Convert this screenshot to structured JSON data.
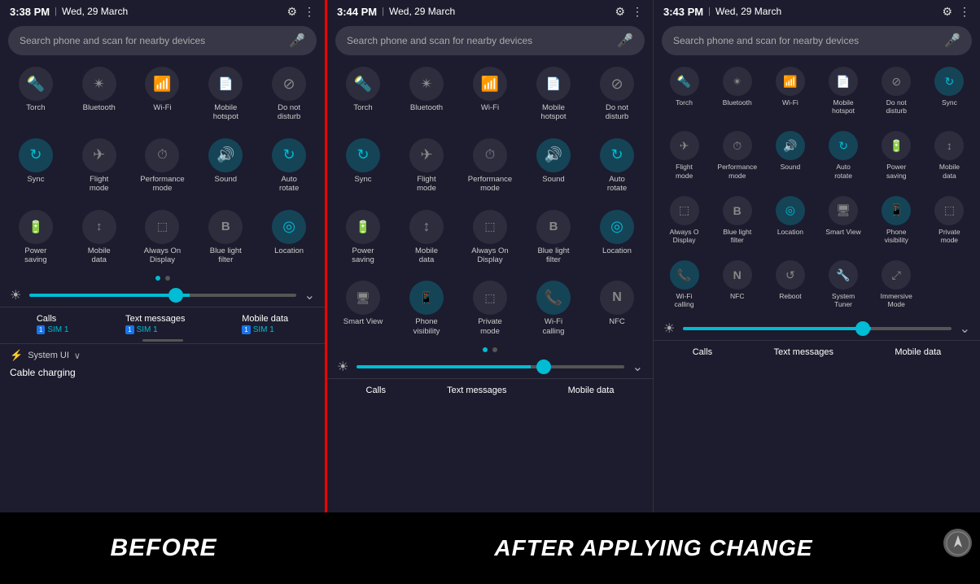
{
  "screens": {
    "before": {
      "time": "3:38 PM",
      "date": "Wed, 29 March",
      "search_placeholder": "Search phone and scan for nearby devices",
      "page1_items": [
        {
          "icon": "🔦",
          "label": "Torch",
          "active": false
        },
        {
          "icon": "⊛",
          "label": "Bluetooth",
          "active": false
        },
        {
          "icon": "≋",
          "label": "Wi-Fi",
          "active": false
        },
        {
          "icon": "⊡",
          "label": "Mobile\nhotspot",
          "active": false
        },
        {
          "icon": "⊘",
          "label": "Do not\ndisturb",
          "active": false
        },
        {
          "icon": "↻",
          "label": "Sync",
          "active": false
        },
        {
          "icon": "✈",
          "label": "Flight\nmode",
          "active": false
        },
        {
          "icon": "⊙",
          "label": "Performance\nmode",
          "active": false
        },
        {
          "icon": "🔊",
          "label": "Sound",
          "active": true
        },
        {
          "icon": "↻",
          "label": "Auto\nrotate",
          "active": true
        },
        {
          "icon": "⊟",
          "label": "Power\nsaving",
          "active": false
        },
        {
          "icon": "↕",
          "label": "Mobile\ndata",
          "active": false
        },
        {
          "icon": "⊡",
          "label": "Always On\nDisplay",
          "active": false
        },
        {
          "icon": "B",
          "label": "Blue light\nfilter",
          "active": false
        },
        {
          "icon": "◎",
          "label": "Location",
          "active": true
        }
      ],
      "calls_label": "Calls",
      "calls_sim": "SIM 1",
      "texts_label": "Text messages",
      "texts_sim": "SIM 1",
      "data_label": "Mobile data",
      "data_sim": "SIM 1",
      "system_label": "System UI",
      "charging_label": "Cable charging"
    },
    "after1": {
      "time": "3:44 PM",
      "date": "Wed, 29 March",
      "search_placeholder": "Search phone and scan for nearby devices",
      "page1_items": [
        {
          "icon": "🔦",
          "label": "Torch",
          "active": false
        },
        {
          "icon": "⊛",
          "label": "Bluetooth",
          "active": false
        },
        {
          "icon": "≋",
          "label": "Wi-Fi",
          "active": false
        },
        {
          "icon": "⊡",
          "label": "Mobile\nhotspot",
          "active": false
        },
        {
          "icon": "⊘",
          "label": "Do not\ndisturb",
          "active": false
        },
        {
          "icon": "↻",
          "label": "Sync",
          "active": false
        },
        {
          "icon": "✈",
          "label": "Flight\nmode",
          "active": false
        },
        {
          "icon": "⊙",
          "label": "Performance\nmode",
          "active": false
        },
        {
          "icon": "🔊",
          "label": "Sound",
          "active": true
        },
        {
          "icon": "↻",
          "label": "Auto\nrotate",
          "active": true
        },
        {
          "icon": "⊟",
          "label": "Power\nsaving",
          "active": false
        },
        {
          "icon": "↕",
          "label": "Mobile\ndata",
          "active": false
        },
        {
          "icon": "⊡",
          "label": "Always On\nDisplay",
          "active": false
        },
        {
          "icon": "B",
          "label": "Blue light\nfilter",
          "active": false
        },
        {
          "icon": "◎",
          "label": "Location",
          "active": true
        },
        {
          "icon": "🖥",
          "label": "Smart View",
          "active": false
        },
        {
          "icon": "📱",
          "label": "Phone\nvisibility",
          "active": true
        },
        {
          "icon": "⊡",
          "label": "Private\nmode",
          "active": false
        },
        {
          "icon": "📞",
          "label": "Wi-Fi\ncalling",
          "active": true
        },
        {
          "icon": "N",
          "label": "NFC",
          "active": false
        }
      ],
      "calls_label": "Calls",
      "texts_label": "Text messages",
      "data_label": "Mobile data"
    },
    "after2": {
      "time": "3:43 PM",
      "date": "Wed, 29 March",
      "search_placeholder": "Search phone and scan for nearby devices",
      "page1_items": [
        {
          "icon": "🔦",
          "label": "Torch",
          "active": false
        },
        {
          "icon": "⊛",
          "label": "Bluetooth",
          "active": false
        },
        {
          "icon": "≋",
          "label": "Wi-Fi",
          "active": false
        },
        {
          "icon": "⊡",
          "label": "Mobile\nhotspot",
          "active": false
        },
        {
          "icon": "⊘",
          "label": "Do not\ndisturb",
          "active": false
        },
        {
          "icon": "↻",
          "label": "Sync",
          "active": true
        },
        {
          "icon": "✈",
          "label": "Flight\nmode",
          "active": false
        },
        {
          "icon": "⊙",
          "label": "Performance\nmode",
          "active": false
        },
        {
          "icon": "🔊",
          "label": "Sound",
          "active": true
        },
        {
          "icon": "↻",
          "label": "Auto\nrotate",
          "active": true
        },
        {
          "icon": "⊟",
          "label": "Power\nsaving",
          "active": false
        },
        {
          "icon": "↕",
          "label": "Mobile\ndata",
          "active": false
        },
        {
          "icon": "⊡",
          "label": "Always On\nDisplay",
          "active": false
        },
        {
          "icon": "B",
          "label": "Blue light\nfilter",
          "active": false
        },
        {
          "icon": "◎",
          "label": "Location",
          "active": true
        },
        {
          "icon": "🖥",
          "label": "Smart View",
          "active": false
        },
        {
          "icon": "📱",
          "label": "Phone\nvisibility",
          "active": true
        },
        {
          "icon": "⊡",
          "label": "Private\nmode",
          "active": false
        },
        {
          "icon": "📞",
          "label": "Wi-Fi\ncalling",
          "active": true
        },
        {
          "icon": "N",
          "label": "NFC",
          "active": false
        },
        {
          "icon": "↻",
          "label": "Reboot",
          "active": false
        },
        {
          "icon": "🔧",
          "label": "System\nTuner",
          "active": false
        },
        {
          "icon": "⤢",
          "label": "Immersive\nMode",
          "active": false
        }
      ],
      "calls_label": "Calls",
      "texts_label": "Text messages",
      "data_label": "Mobile data"
    }
  },
  "labels": {
    "before": "BEFORE",
    "after": "AFTER APPLYING CHANGE"
  },
  "colors": {
    "active": "#00bcd4",
    "inactive": "#888888",
    "bg": "#1c1c2e",
    "label_bar": "#000000"
  }
}
